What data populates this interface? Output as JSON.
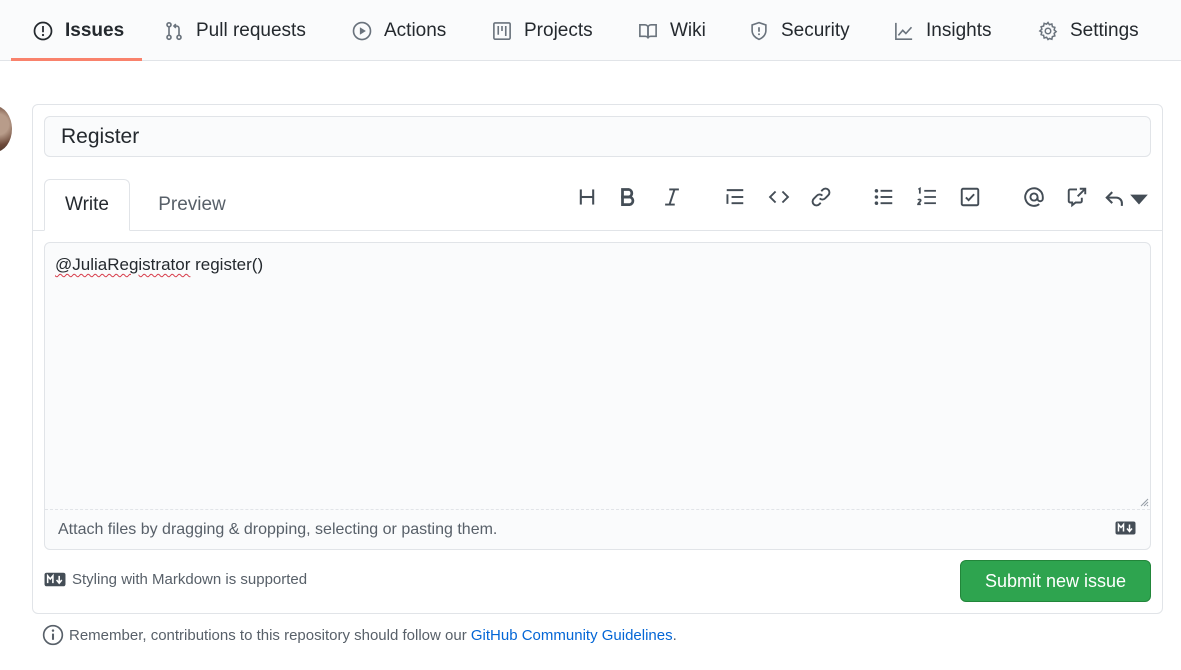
{
  "nav": {
    "tabs": [
      {
        "label": "Issues",
        "icon": "issue-opened-icon",
        "selected": true
      },
      {
        "label": "Pull requests",
        "icon": "git-pull-request-icon"
      },
      {
        "label": "Actions",
        "icon": "play-icon"
      },
      {
        "label": "Projects",
        "icon": "project-icon"
      },
      {
        "label": "Wiki",
        "icon": "book-icon"
      },
      {
        "label": "Security",
        "icon": "shield-icon"
      },
      {
        "label": "Insights",
        "icon": "graph-icon"
      },
      {
        "label": "Settings",
        "icon": "gear-icon"
      }
    ],
    "selected_underline_color": "#f9826c"
  },
  "issue": {
    "title_value": "Register",
    "tabs": {
      "write": "Write",
      "preview": "Preview"
    },
    "body_mention": "@JuliaRegistrator",
    "body_rest": " register()",
    "attach_hint": "Attach files by dragging & dropping, selecting or pasting them.",
    "markdown_note": "Styling with Markdown is supported",
    "submit_label": "Submit new issue"
  },
  "toolbar": [
    "header-icon",
    "bold-icon",
    "italic-icon",
    "quote-icon",
    "code-icon",
    "link-icon",
    "unordered-list-icon",
    "ordered-list-icon",
    "tasklist-icon",
    "mention-icon",
    "cross-reference-icon",
    "reply-icon"
  ],
  "footer": {
    "remember_text": "Remember, contributions to this repository should follow our ",
    "guidelines_link": "GitHub Community Guidelines",
    "period": "."
  },
  "colors": {
    "submit_bg": "#2ea44f",
    "link": "#0366d6"
  }
}
